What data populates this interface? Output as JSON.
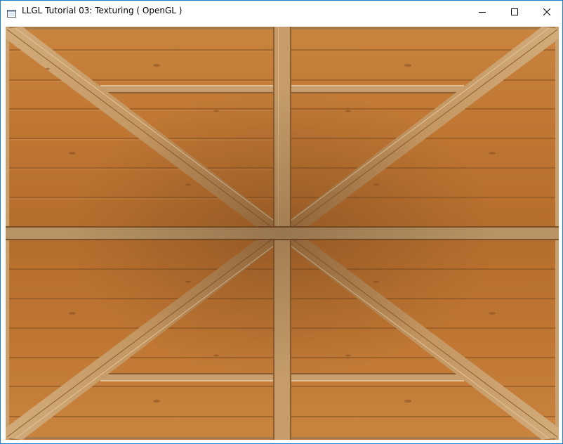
{
  "window": {
    "title": "LLGL Tutorial 03: Texturing ( OpenGL )",
    "accent_border": "#1883d7"
  },
  "titlebar": {
    "icon": "app-window-icon",
    "buttons": [
      {
        "name": "minimize",
        "icon": "minimize-icon"
      },
      {
        "name": "maximize",
        "icon": "maximize-icon"
      },
      {
        "name": "close",
        "icon": "close-icon"
      }
    ]
  },
  "viewport": {
    "content": "rendered texture of a wooden plank ceiling with crossed X beams",
    "texture_colors": {
      "plank": "#c07a37",
      "beam": "#c59c6a",
      "seam": "#8a5422"
    }
  }
}
